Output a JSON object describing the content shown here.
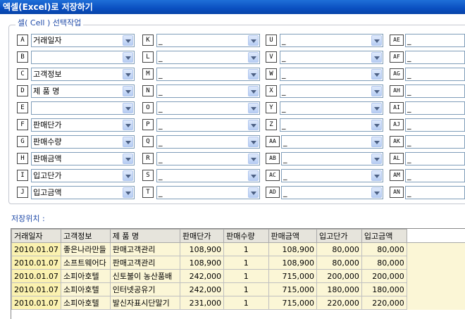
{
  "window": {
    "title": "엑셀(Excel)로 저장하기"
  },
  "cell_group": {
    "title": "셀( Cell ) 선택작업"
  },
  "columns": [
    [
      {
        "key": "A",
        "value": "거래일자"
      },
      {
        "key": "B",
        "value": ""
      },
      {
        "key": "C",
        "value": "고객정보"
      },
      {
        "key": "D",
        "value": "제 품 명"
      },
      {
        "key": "E",
        "value": ""
      },
      {
        "key": "F",
        "value": "판매단가"
      },
      {
        "key": "G",
        "value": "판매수량"
      },
      {
        "key": "H",
        "value": "판매금액"
      },
      {
        "key": "I",
        "value": "입고단가"
      },
      {
        "key": "J",
        "value": "입고금액"
      }
    ],
    [
      {
        "key": "K",
        "value": "_"
      },
      {
        "key": "L",
        "value": "_"
      },
      {
        "key": "M",
        "value": "_"
      },
      {
        "key": "N",
        "value": "_"
      },
      {
        "key": "O",
        "value": "_"
      },
      {
        "key": "P",
        "value": "_"
      },
      {
        "key": "Q",
        "value": "_"
      },
      {
        "key": "R",
        "value": "_"
      },
      {
        "key": "S",
        "value": "_"
      },
      {
        "key": "T",
        "value": "_"
      }
    ],
    [
      {
        "key": "U",
        "value": "_"
      },
      {
        "key": "V",
        "value": "_"
      },
      {
        "key": "W",
        "value": "_"
      },
      {
        "key": "X",
        "value": "_"
      },
      {
        "key": "Y",
        "value": "_"
      },
      {
        "key": "Z",
        "value": "_"
      },
      {
        "key": "AA",
        "value": "_"
      },
      {
        "key": "AB",
        "value": "_"
      },
      {
        "key": "AC",
        "value": "_"
      },
      {
        "key": "AD",
        "value": "_"
      }
    ],
    [
      {
        "key": "AE",
        "value": "_"
      },
      {
        "key": "AF",
        "value": "_"
      },
      {
        "key": "AG",
        "value": "_"
      },
      {
        "key": "AH",
        "value": "_"
      },
      {
        "key": "AI",
        "value": "_"
      },
      {
        "key": "AJ",
        "value": "_"
      },
      {
        "key": "AK",
        "value": "_"
      },
      {
        "key": "AL",
        "value": "_"
      },
      {
        "key": "AM",
        "value": "_"
      },
      {
        "key": "AN",
        "value": "_"
      }
    ]
  ],
  "save_location": {
    "label": "저장위치 :"
  },
  "grid": {
    "headers": [
      "거래일자",
      "고객정보",
      "제 품 명",
      "판매단가",
      "판매수량",
      "판매금액",
      "입고단가",
      "입고금액"
    ],
    "rows": [
      [
        "2010.01.07",
        "좋은나라만들",
        "판매고객관리",
        "108,900",
        "1",
        "108,900",
        "80,000",
        "80,000"
      ],
      [
        "2010.01.07",
        "소프트웨어다",
        "판매고객관리",
        "108,900",
        "1",
        "108,900",
        "80,000",
        "80,000"
      ],
      [
        "2010.01.07",
        "소피아호텔",
        "신토불이 농산품배",
        "242,000",
        "1",
        "715,000",
        "200,000",
        "200,000"
      ],
      [
        "2010.01.07",
        "소피아호텔",
        "인터넷공유기",
        "242,000",
        "1",
        "715,000",
        "180,000",
        "180,000"
      ],
      [
        "2010.01.07",
        "소피아호텔",
        "발신자표시단말기",
        "231,000",
        "1",
        "715,000",
        "220,000",
        "220,000"
      ]
    ]
  }
}
